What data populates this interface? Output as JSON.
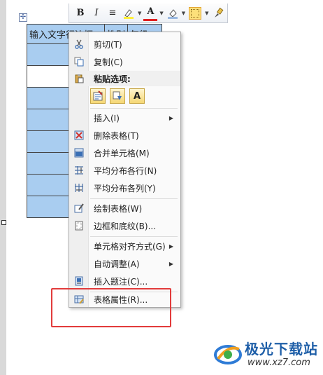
{
  "table": {
    "header": [
      "输入文字行边框",
      "性别",
      "年级"
    ],
    "row_count": 9
  },
  "mini_toolbar": {
    "bold": "B",
    "italic": "I",
    "align": "≡",
    "font_color": "A"
  },
  "context_menu": {
    "cut": "剪切(T)",
    "copy": "复制(C)",
    "paste_options": "粘贴选项:",
    "paste_keep_text": "A",
    "insert": "插入(I)",
    "delete_table": "删除表格(T)",
    "merge_cells": "合并单元格(M)",
    "distribute_rows": "平均分布各行(N)",
    "distribute_columns": "平均分布各列(Y)",
    "draw_table": "绘制表格(W)",
    "borders_shading": "边框和底纹(B)...",
    "cell_alignment": "单元格对齐方式(G)",
    "autofit": "自动调整(A)",
    "insert_caption": "插入题注(C)...",
    "table_properties": "表格属性(R)..."
  },
  "watermark": {
    "title": "极光下载站",
    "url": "www.xz7.com"
  },
  "colors": {
    "selection": "#a9cdf0",
    "highlight": "#e23b3b",
    "watermark": "#1f5fa8"
  }
}
